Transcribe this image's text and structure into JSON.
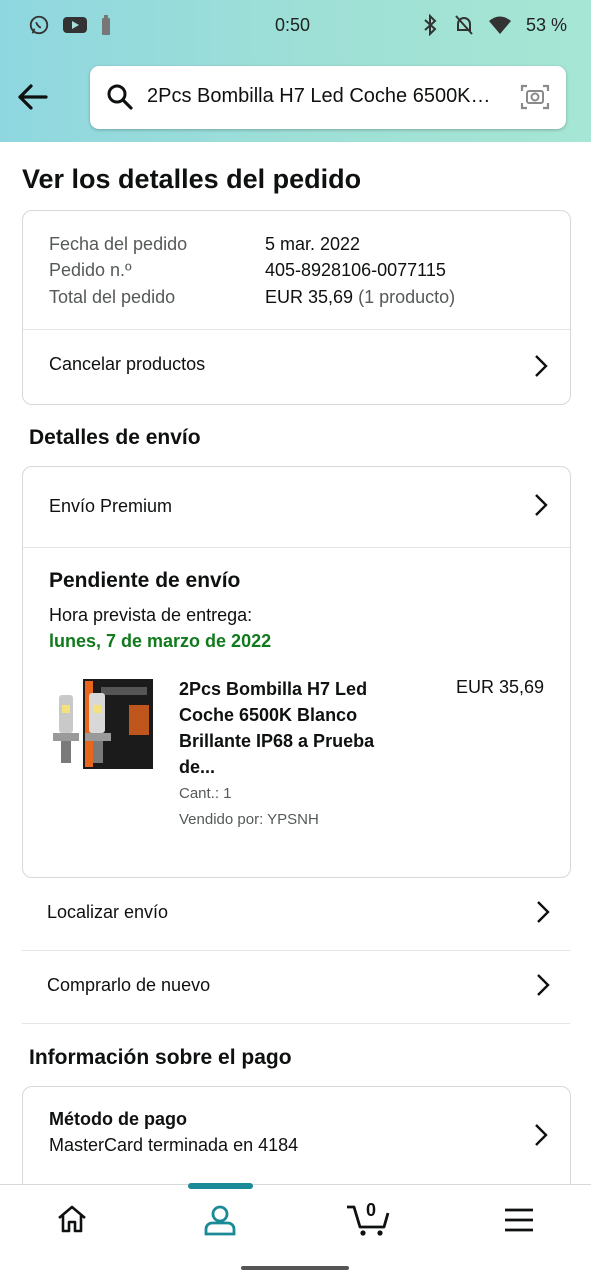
{
  "status_bar": {
    "time": "0:50",
    "battery": "53 %",
    "icons": [
      "whatsapp-icon",
      "youtube-icon",
      "battery-saver-icon",
      "bluetooth-icon",
      "notifications-off-icon",
      "wifi-icon"
    ]
  },
  "search": {
    "query": "2Pcs Bombilla H7 Led Coche 6500K…"
  },
  "page": {
    "title": "Ver los detalles del pedido"
  },
  "order_summary": {
    "date_label": "Fecha del pedido",
    "date_value": "5 mar. 2022",
    "order_label": "Pedido n.º",
    "order_value": "405-8928106-0077115",
    "total_label": "Total del pedido",
    "total_value": "EUR 35,69",
    "total_items": "(1 producto)",
    "cancel_label": "Cancelar productos"
  },
  "shipping": {
    "section_title": "Detalles de envío",
    "method": "Envío Premium",
    "status": "Pendiente de envío",
    "eta_label": "Hora prevista de entrega:",
    "eta_date": "lunes, 7 de marzo de 2022",
    "product": {
      "title": "2Pcs Bombilla H7 Led Coche 6500K Blanco Brillante IP68 a Prueba de...",
      "price": "EUR 35,69",
      "qty": "Cant.: 1",
      "seller": "Vendido por: YPSNH"
    },
    "track_label": "Localizar envío",
    "buy_again_label": "Comprarlo de nuevo"
  },
  "payment": {
    "section_title": "Información sobre el pago",
    "method_title": "Método de pago",
    "method_value": "MasterCard terminada en 4184"
  },
  "bottom_nav": {
    "cart_count": "0",
    "items": [
      "home-icon",
      "account-icon",
      "cart-icon",
      "menu-icon"
    ]
  },
  "colors": {
    "header_gradient_start": "#8fd7e0",
    "header_gradient_end": "#a6e6d4",
    "eta_green": "#117a1c",
    "active_tab": "#1a8a96"
  }
}
